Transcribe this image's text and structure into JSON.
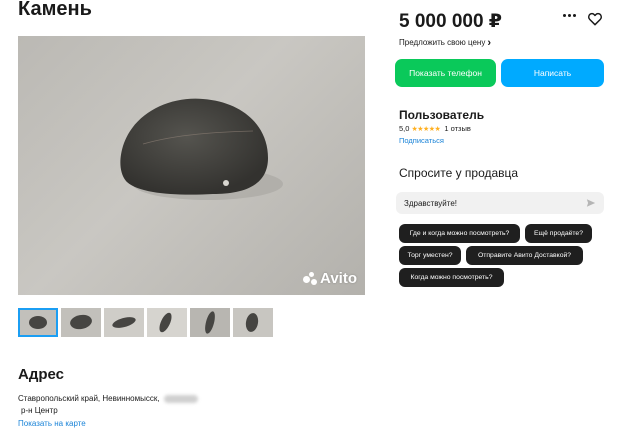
{
  "listing": {
    "title": "Камень",
    "watermark": "Avito",
    "thumbnails_count": 6,
    "active_thumbnail": 1
  },
  "address": {
    "heading": "Адрес",
    "line": "Ставропольский край, Невинномысск,",
    "district": "р-н Центр",
    "map_link": "Показать на карте"
  },
  "price": {
    "amount": "5 000 000 ₽",
    "offer_label": "Предложить свою цену",
    "offer_chevron": "›"
  },
  "actions": {
    "show_phone": "Показать телефон",
    "write": "Написать",
    "more_icon": "more-dots-icon",
    "favorite_icon": "heart-icon"
  },
  "seller": {
    "name": "Пользователь",
    "rating": "5,0",
    "stars": "★★★★★",
    "reviews": "1 отзыв",
    "subscribe": "Подписаться"
  },
  "ask": {
    "heading": "Спросите у продавца",
    "input_value": "Здравствуйте!",
    "chips": [
      "Где и когда можно посмотреть?",
      "Ещё продаёте?",
      "Торг уместен?",
      "Отправите Авито Доставкой?",
      "Когда можно посмотреть?"
    ]
  },
  "colors": {
    "phone_button": "#0ac95a",
    "write_button": "#00aaff",
    "link": "#1b84d8",
    "star": "#ffb021",
    "chip_bg": "#1f1f1f"
  }
}
